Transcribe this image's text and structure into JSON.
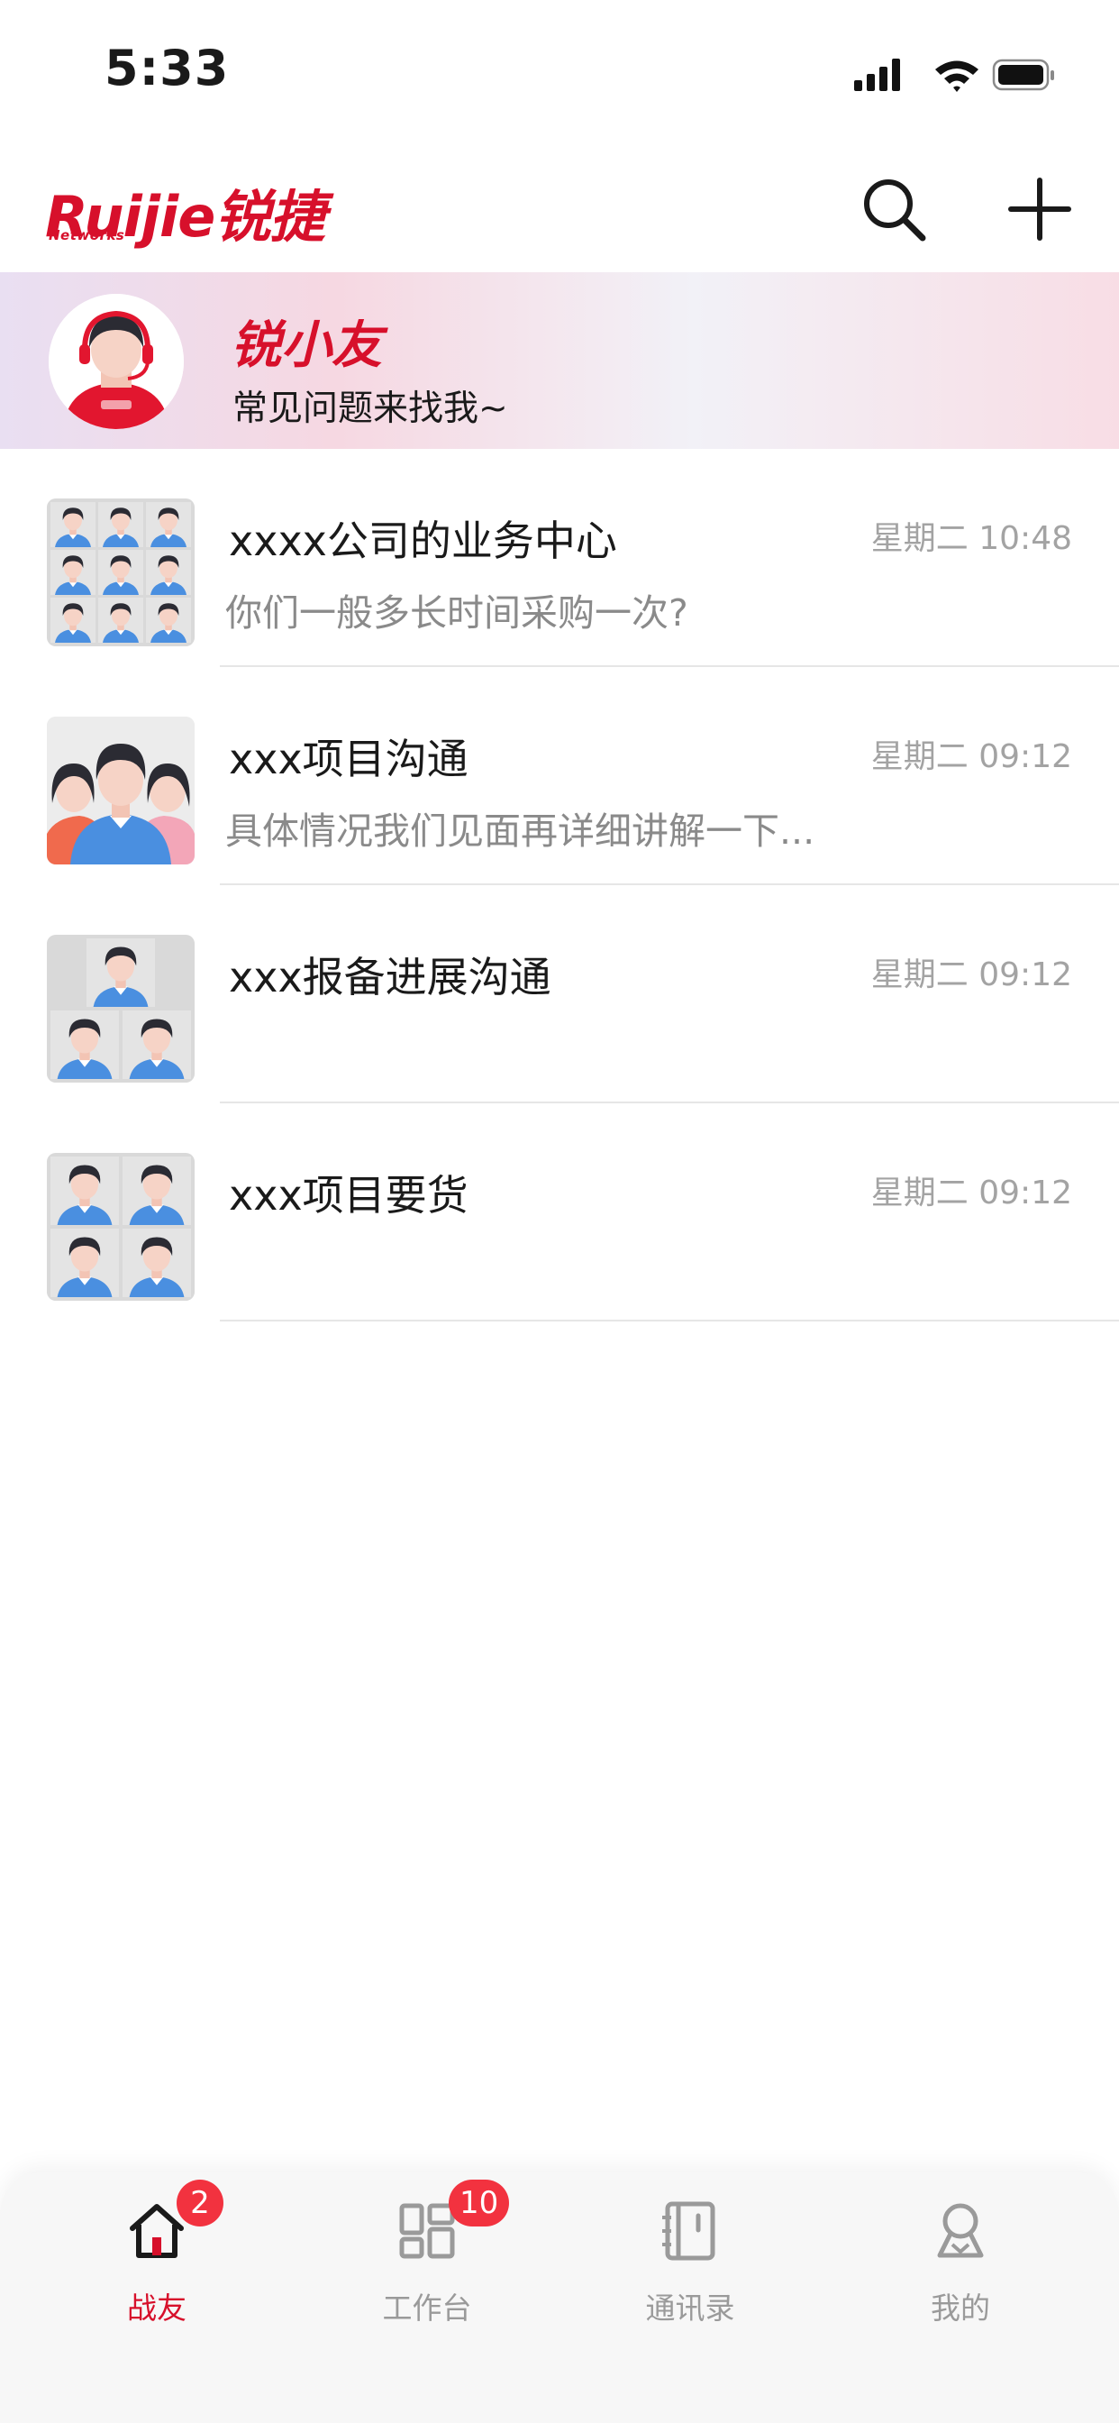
{
  "status_bar": {
    "time": "5:33"
  },
  "header": {
    "logo_text": "Ruijie锐捷",
    "logo_sub": "Networks"
  },
  "assistant": {
    "name": "锐小友",
    "description": "常见问题来找我~"
  },
  "chats": [
    {
      "title": "xxxx公司的业务中心",
      "day": "星期二",
      "time": "10:48",
      "preview": "你们一般多长时间采购一次?"
    },
    {
      "title": "xxx项目沟通",
      "day": "星期二",
      "time": "09:12",
      "preview": "具体情况我们见面再详细讲解一下..."
    },
    {
      "title": "xxx报备进展沟通",
      "day": "星期二",
      "time": "09:12",
      "preview": ""
    },
    {
      "title": "xxx项目要货",
      "day": "星期二",
      "time": "09:12",
      "preview": ""
    }
  ],
  "tabs": [
    {
      "label": "战友",
      "icon": "home-icon",
      "badge": "2",
      "active": true
    },
    {
      "label": "工作台",
      "icon": "workbench-icon",
      "badge": "10",
      "active": false
    },
    {
      "label": "通讯录",
      "icon": "contacts-book-icon",
      "badge": "",
      "active": false
    },
    {
      "label": "我的",
      "icon": "profile-icon",
      "badge": "",
      "active": false
    }
  ],
  "colors": {
    "brand": "#d7102b",
    "badge": "#f2323f",
    "inactive": "#9a9a9a",
    "avatar_shirt": "#4a8fe0"
  }
}
